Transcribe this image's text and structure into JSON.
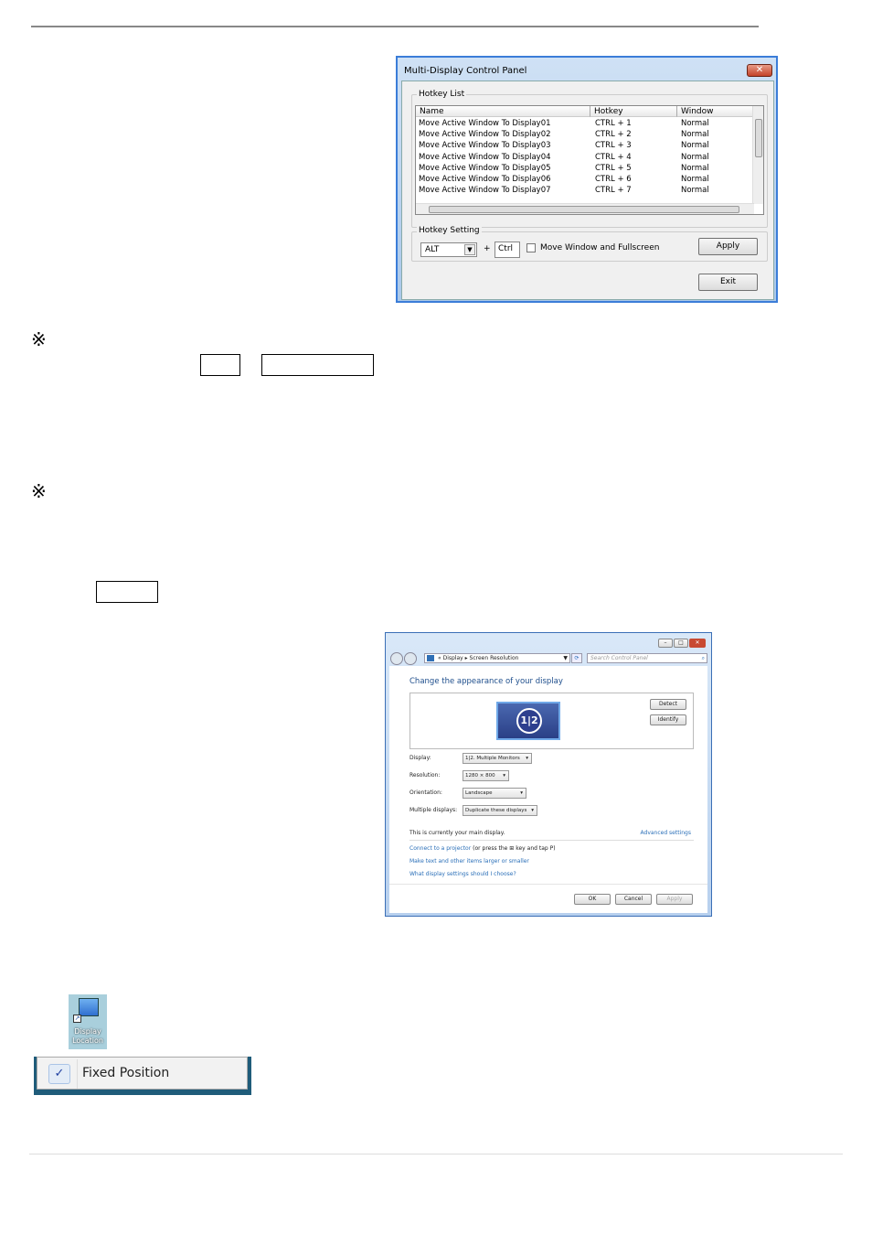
{
  "dialog1": {
    "title": "Multi-Display Control Panel",
    "close_icon": "close-icon",
    "hotkey_list_label": "Hotkey List",
    "columns": [
      "Name",
      "Hotkey",
      "Window"
    ],
    "rows": [
      [
        "Move Active Window To Display01",
        "CTRL + 1",
        "Normal"
      ],
      [
        "Move Active Window To Display02",
        "CTRL + 2",
        "Normal"
      ],
      [
        "Move Active Window To Display03",
        "CTRL + 3",
        "Normal"
      ],
      [
        "Move Active Window To Display04",
        "CTRL + 4",
        "Normal"
      ],
      [
        "Move Active Window To Display05",
        "CTRL + 5",
        "Normal"
      ],
      [
        "Move Active Window To Display06",
        "CTRL + 6",
        "Normal"
      ],
      [
        "Move Active Window To Display07",
        "CTRL + 7",
        "Normal"
      ]
    ],
    "hotkey_setting_label": "Hotkey Setting",
    "modifier_select": "ALT",
    "plus": "+",
    "key_field": "Ctrl",
    "checkbox_label": "Move Window and Fullscreen",
    "apply": "Apply",
    "exit": "Exit"
  },
  "note_mark": "※",
  "dialog2": {
    "breadcrumb": [
      "Display",
      "Screen Resolution"
    ],
    "search_placeholder": "Search Control Panel",
    "heading": "Change the appearance of your display",
    "detect": "Detect",
    "identify": "Identify",
    "monitor_numbers": [
      "1",
      "2"
    ],
    "fields": [
      {
        "label": "Display:",
        "value": "1|2. Multiple Monitors"
      },
      {
        "label": "Resolution:",
        "value": "1280 × 800"
      },
      {
        "label": "Orientation:",
        "value": "Landscape"
      },
      {
        "label": "Multiple displays:",
        "value": "Duplicate these displays"
      }
    ],
    "main_display_text": "This is currently your main display.",
    "advanced_settings": "Advanced settings",
    "projector_link": "Connect to a projector",
    "projector_suffix": "(or press the",
    "projector_suffix2": "key and tap P)",
    "link_text_size": "Make text and other items larger or smaller",
    "link_settings_help": "What display settings should I choose?",
    "ok": "OK",
    "cancel": "Cancel",
    "apply": "Apply"
  },
  "desktop_icon": {
    "label1": "Display",
    "label2": "Location"
  },
  "context_menu": {
    "item": "Fixed Position",
    "checked": true
  }
}
